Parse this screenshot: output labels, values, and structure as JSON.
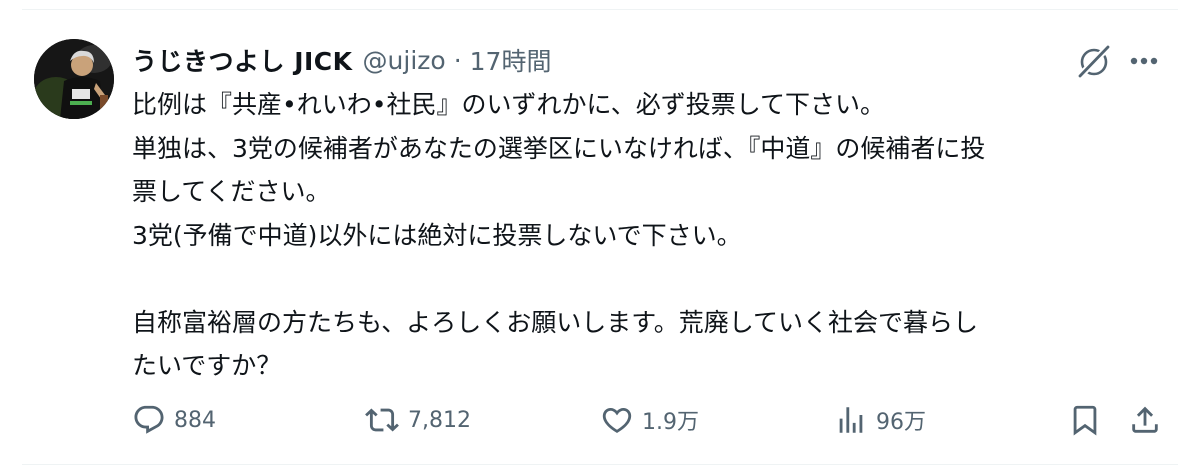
{
  "tweet": {
    "display_name": "うじきつよし JICK",
    "handle": "@ujizo",
    "separator": "·",
    "time": "17時間",
    "lines": [
      "比例は『共産•れいわ•社民』のいずれかに、必ず投票して下さい。",
      "単独は、3党の候補者があなたの選挙区にいなければ、『中道』の候補者に投",
      "票してください。",
      "3党(予備で中道)以外には絶対に投票しないで下さい。",
      "",
      "自称富裕層の方たちも、よろしくお願いします。荒廃していく社会で暮らし",
      "たいですか？"
    ]
  },
  "actions": {
    "replies": "884",
    "retweets": "7,812",
    "likes": "1.9万",
    "views": "96万"
  },
  "icons": {
    "grok": "grok-icon",
    "more": "more-icon",
    "reply": "reply-icon",
    "retweet": "retweet-icon",
    "like": "heart-icon",
    "views": "views-icon",
    "bookmark": "bookmark-icon",
    "share": "share-icon"
  },
  "colors": {
    "text": "#0f1419",
    "secondary": "#536471",
    "border": "#eff3f4"
  }
}
